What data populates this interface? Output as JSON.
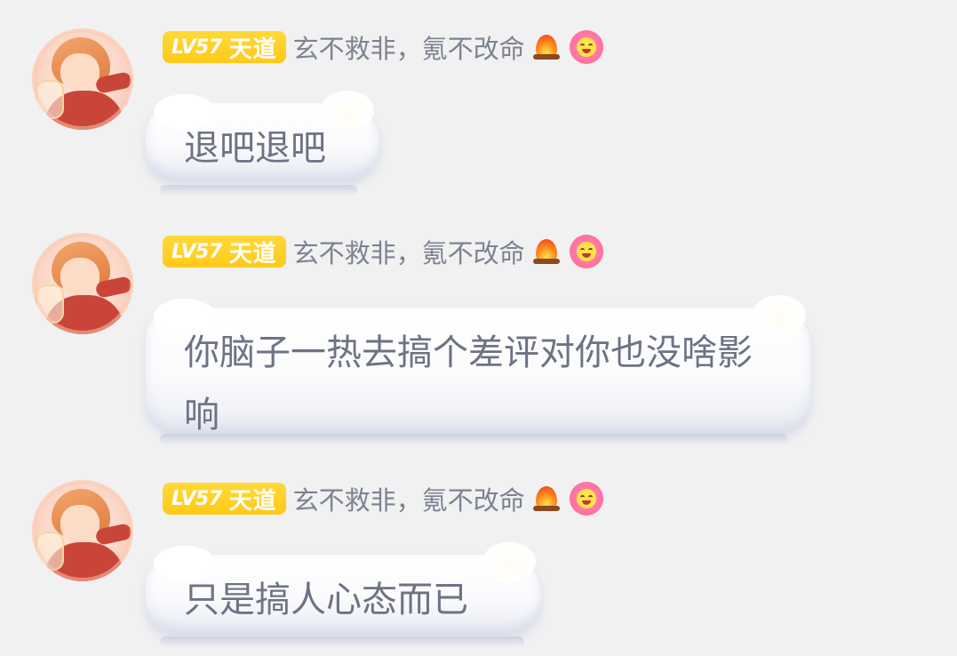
{
  "messages": [
    {
      "badge": {
        "level": "LV57",
        "rank": "天道"
      },
      "nickname": "玄不救非，氪不改命",
      "emojis": [
        "fire-emoji",
        "smiling-flower-emoji"
      ],
      "text": "退吧退吧"
    },
    {
      "badge": {
        "level": "LV57",
        "rank": "天道"
      },
      "nickname": "玄不救非，氪不改命",
      "emojis": [
        "fire-emoji",
        "smiling-flower-emoji"
      ],
      "text": "你脑子一热去搞个差评对你也没啥影响"
    },
    {
      "badge": {
        "level": "LV57",
        "rank": "天道"
      },
      "nickname": "玄不救非，氪不改命",
      "emojis": [
        "fire-emoji",
        "smiling-flower-emoji"
      ],
      "text": "只是搞人心态而已"
    }
  ],
  "colors": {
    "background": "#f1f1f2",
    "badge": "#ffcf24",
    "nickname": "#7c8391",
    "message_text": "#6d7384",
    "bubble": "#ffffff"
  }
}
